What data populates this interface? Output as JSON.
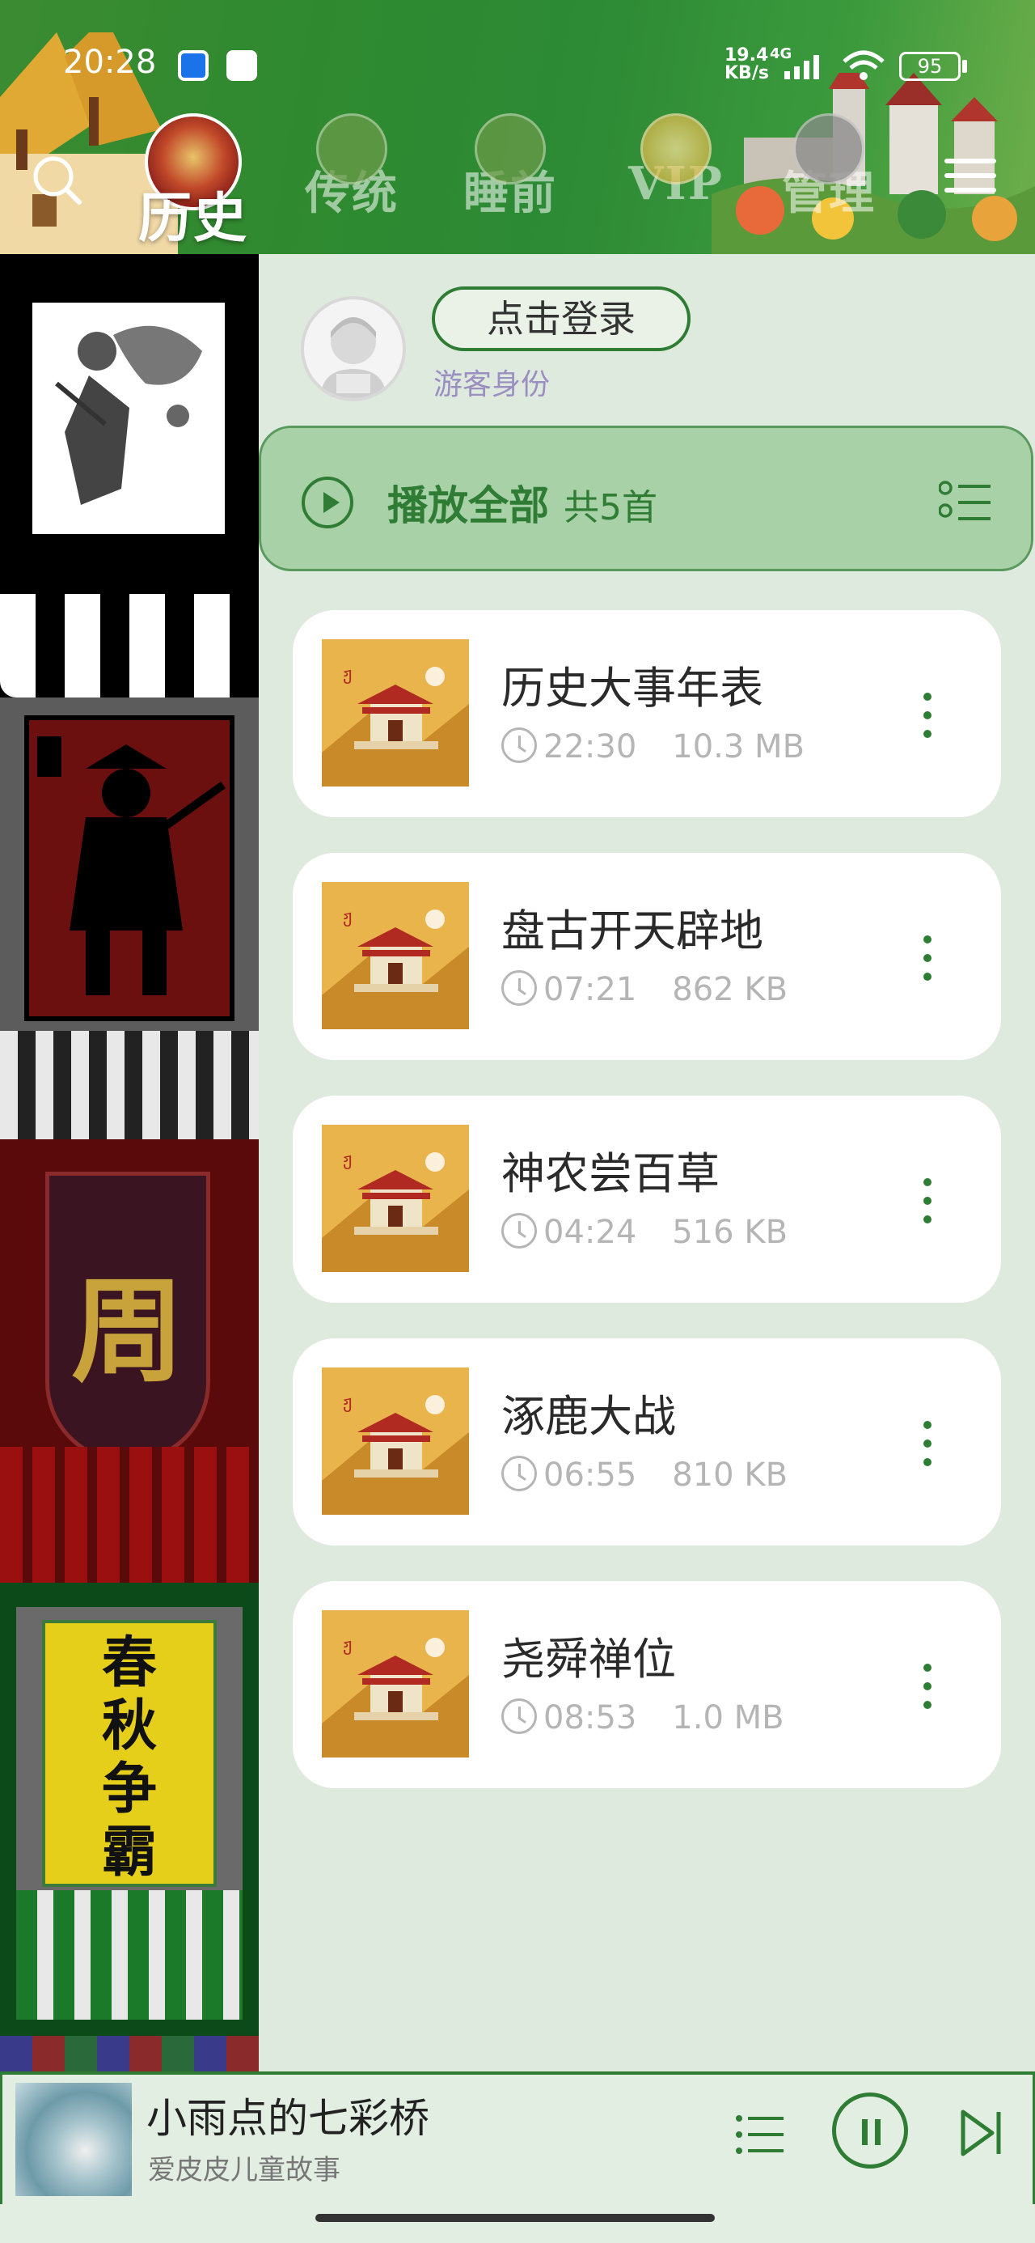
{
  "status_bar": {
    "time": "20:28",
    "net_speed": "19.4\nKB/s",
    "net_type": "4G",
    "battery": "95"
  },
  "tabs": [
    {
      "label": "历史",
      "active": true
    },
    {
      "label": "传统",
      "active": false
    },
    {
      "label": "睡前",
      "active": false
    },
    {
      "label": "VIP",
      "active": false
    },
    {
      "label": "管理",
      "active": false
    }
  ],
  "icons": {
    "search": "search-icon",
    "menu": "hamburger-menu-icon",
    "play": "play-icon",
    "list": "playlist-icon",
    "clock": "clock-icon",
    "more": "more-vertical-icon",
    "pause": "pause-icon",
    "next": "skip-next-icon"
  },
  "account": {
    "login_label": "点击登录",
    "role": "游客身份"
  },
  "playall": {
    "label": "播放全部",
    "count": "共5首"
  },
  "tracks": [
    {
      "title": "历史大事年表",
      "duration": "22:30",
      "size": "10.3 MB"
    },
    {
      "title": "盘古开天辟地",
      "duration": "07:21",
      "size": "862 KB"
    },
    {
      "title": "神农尝百草",
      "duration": "04:24",
      "size": "516 KB"
    },
    {
      "title": "涿鹿大战",
      "duration": "06:55",
      "size": "810 KB"
    },
    {
      "title": "尧舜禅位",
      "duration": "08:53",
      "size": "1.0 MB"
    }
  ],
  "banners": [
    {
      "label": ""
    },
    {
      "label": ""
    },
    {
      "label": "周"
    },
    {
      "label": "春\n秋\n争\n霸"
    }
  ],
  "player": {
    "title": "小雨点的七彩桥",
    "subtitle": "爱皮皮儿童故事"
  },
  "colors": {
    "accent": "#2f7d34",
    "header": "#2f8a2f",
    "background": "#dfeadf",
    "thumb": "#e8b54a"
  }
}
